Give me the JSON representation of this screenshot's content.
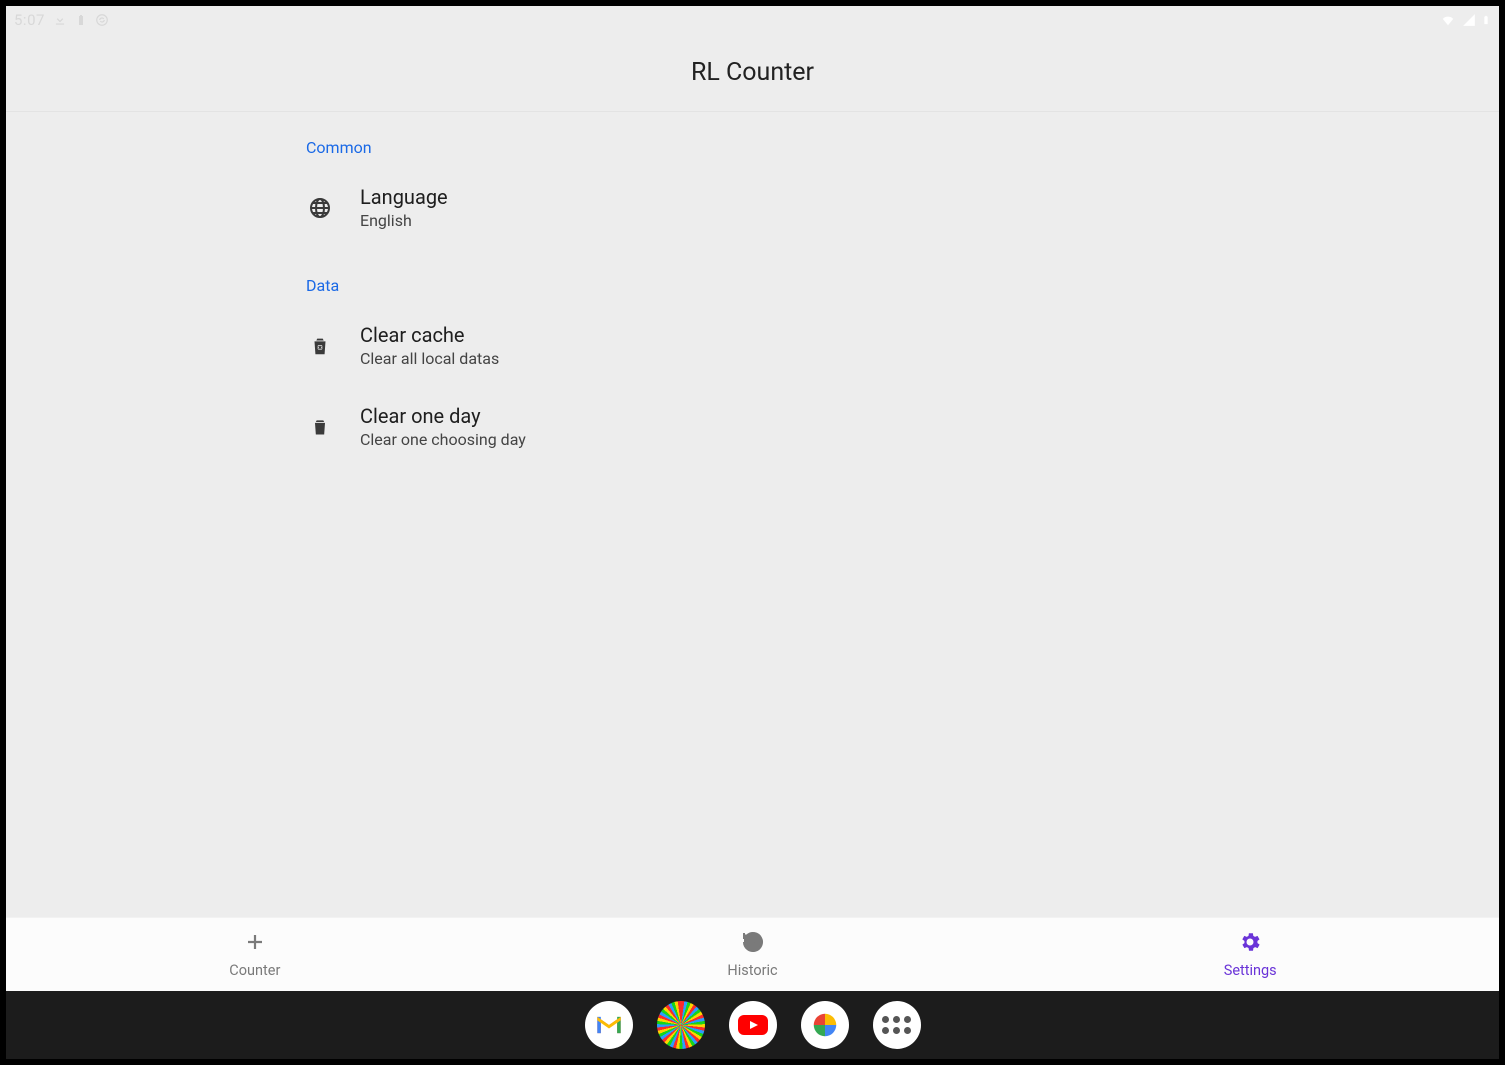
{
  "status": {
    "time": "5:07"
  },
  "app": {
    "title": "RL Counter"
  },
  "settings": {
    "sections": [
      {
        "header": "Common",
        "items": [
          {
            "title": "Language",
            "subtitle": "English"
          }
        ]
      },
      {
        "header": "Data",
        "items": [
          {
            "title": "Clear cache",
            "subtitle": "Clear all local datas"
          },
          {
            "title": "Clear one day",
            "subtitle": "Clear one choosing day"
          }
        ]
      }
    ]
  },
  "nav": {
    "items": [
      {
        "label": "Counter",
        "active": false
      },
      {
        "label": "Historic",
        "active": false
      },
      {
        "label": "Settings",
        "active": true
      }
    ]
  },
  "dock": {
    "apps": [
      "gmail",
      "pixel-art",
      "youtube",
      "google-photos",
      "all-apps"
    ]
  },
  "colors": {
    "accent": "#6a34d8",
    "link": "#1a69e6"
  }
}
